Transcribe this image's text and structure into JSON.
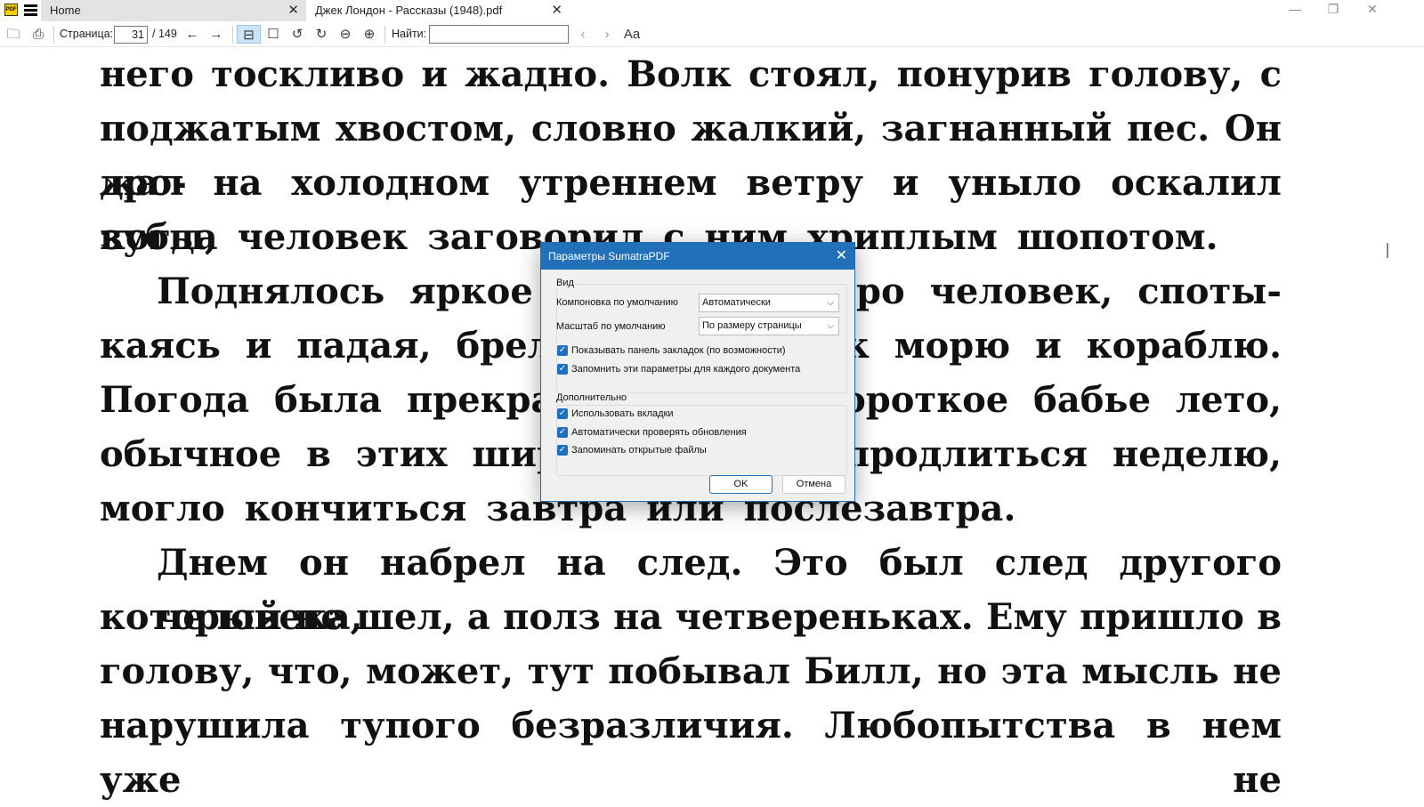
{
  "tabs": [
    {
      "label": "Home"
    },
    {
      "label": "Джек Лондон - Рассказы (1948).pdf"
    }
  ],
  "window_controls": {
    "minimize": "—",
    "maximize": "❐",
    "close": "✕"
  },
  "toolbar": {
    "page_label": "Страница:",
    "page_current": "31",
    "page_total": "/ 149",
    "find_label": "Найти:",
    "find_value": "",
    "font_icon": "Aa"
  },
  "document": {
    "lines": [
      "него тоскливо и жадно. Волк стоял, понурив голову, с",
      "поджатым хвостом, словно жалкий, загнанный пес. Он дро-",
      "жал на холодном утреннем ветру и уныло оскалил зубы,",
      "когда человек заговорил с ним хриплым шопотом."
    ],
    "split_lines": [
      {
        "left": "Поднялось яркое с",
        "right": "утро человек, споты-"
      },
      {
        "left": "каясь и падая, брел п",
        "right": "к морю и кораблю."
      },
      {
        "left": "Погода была прекрас",
        "right": "короткое бабье лето,"
      },
      {
        "left": "обычное в этих широ",
        "right": "о продлиться неделю,"
      }
    ],
    "lines2": [
      "могло кончиться завтра или послезавтра.",
      "Днем он набрел на след. Это был след другого человека,",
      "который не шел, а полз на четвереньках. Ему пришло в",
      "голову, что, может, тут побывал Билл, но эта мысль не",
      "нарушила тупого безразличия. Любопытства в нем уже не"
    ]
  },
  "dialog": {
    "title": "Параметры SumatraPDF",
    "close": "✕",
    "view_group": "Вид",
    "layout_label": "Компоновка по умолчанию",
    "layout_value": "Автоматически",
    "zoom_label": "Масштаб по умолчанию",
    "zoom_value": "По размеру страницы",
    "view_checks": [
      {
        "label": "Показывать панель закладок (по возможности)",
        "checked": true
      },
      {
        "label": "Запомнить эти параметры для каждого документа",
        "checked": true
      }
    ],
    "advanced_group": "Дополнительно",
    "advanced_checks": [
      {
        "label": "Использовать вкладки",
        "checked": true
      },
      {
        "label": "Автоматически проверять обновления",
        "checked": true
      },
      {
        "label": "Запоминать открытые файлы",
        "checked": true
      }
    ],
    "ok": "OK",
    "cancel": "Отмена"
  },
  "colors": {
    "accent": "#2170b8",
    "checkbox": "#1f6fc1"
  }
}
